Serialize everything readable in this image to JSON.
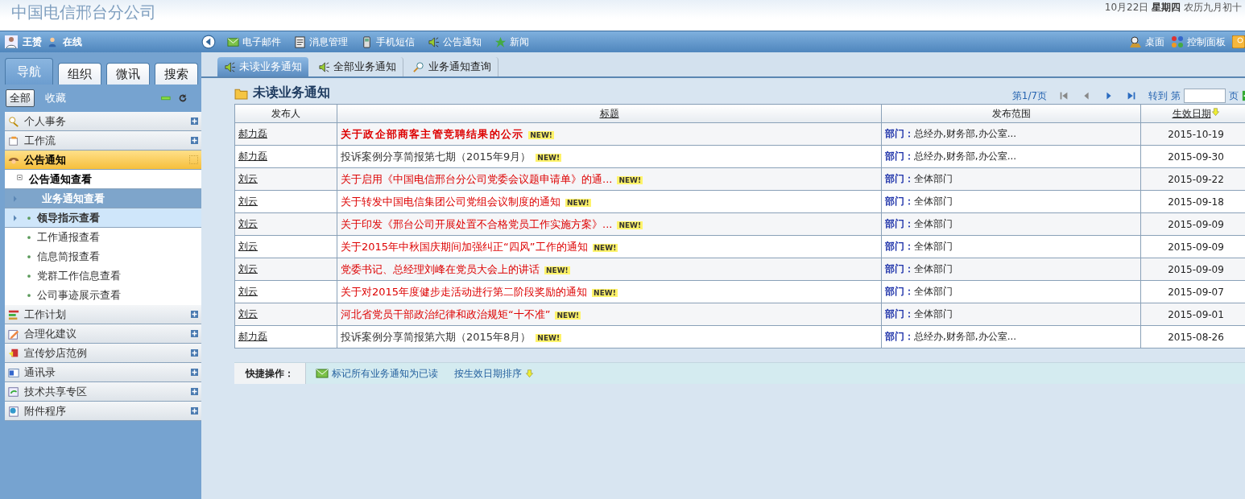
{
  "header": {
    "title": "中国电信邢台分公司",
    "date": "10月22日",
    "weekday": "星期四",
    "lunar": "农历九月初十"
  },
  "topbar": {
    "user": "王赟",
    "status": "在线",
    "menu": [
      {
        "kind": "mail",
        "label": "电子邮件"
      },
      {
        "kind": "message",
        "label": "消息管理"
      },
      {
        "kind": "phone",
        "label": "手机短信"
      },
      {
        "kind": "speaker",
        "label": "公告通知"
      },
      {
        "kind": "star",
        "label": "新闻"
      }
    ],
    "right": [
      {
        "kind": "desktop",
        "label": "桌面"
      },
      {
        "kind": "dots",
        "label": "控制面板"
      }
    ]
  },
  "sidebar": {
    "tabs": [
      {
        "label": "导航",
        "selected": true
      },
      {
        "label": "组织",
        "selected": false
      },
      {
        "label": "微讯",
        "selected": false
      },
      {
        "label": "搜索",
        "selected": false
      }
    ],
    "filters": [
      {
        "label": "全部",
        "selected": true
      },
      {
        "label": "收藏",
        "selected": false
      }
    ],
    "groups": [
      {
        "kind": "person",
        "label": "个人事务",
        "expanded": false
      },
      {
        "kind": "flow",
        "label": "工作流",
        "expanded": false
      },
      {
        "kind": "notice",
        "label": "公告通知",
        "expanded": true,
        "children": [
          {
            "label": "公告通知查看",
            "expanded": true,
            "children": [
              {
                "label": "业务通知查看",
                "selected": true,
                "hovered": false
              },
              {
                "label": "领导指示查看",
                "selected": false,
                "hovered": true
              },
              {
                "label": "工作通报查看",
                "selected": false,
                "hovered": false
              },
              {
                "label": "信息简报查看",
                "selected": false,
                "hovered": false
              },
              {
                "label": "党群工作信息查看",
                "selected": false,
                "hovered": false
              },
              {
                "label": "公司事迹展示查看",
                "selected": false,
                "hovered": false
              }
            ]
          }
        ]
      },
      {
        "kind": "plan",
        "label": "工作计划",
        "expanded": false
      },
      {
        "kind": "pencil",
        "label": "合理化建议",
        "expanded": false
      },
      {
        "kind": "promo",
        "label": "宣传炒店范例",
        "expanded": false
      },
      {
        "kind": "contacts",
        "label": "通讯录",
        "expanded": false
      },
      {
        "kind": "share",
        "label": "技术共享专区",
        "expanded": false
      },
      {
        "kind": "attach",
        "label": "附件程序",
        "expanded": false
      }
    ]
  },
  "tabs": [
    {
      "kind": "speaker",
      "label": "未读业务通知",
      "selected": true
    },
    {
      "kind": "speaker",
      "label": "全部业务通知",
      "selected": false
    },
    {
      "kind": "search",
      "label": "业务通知查询",
      "selected": false
    }
  ],
  "panel": {
    "title": "未读业务通知",
    "page": "第1/7页",
    "goto": "转到 第",
    "page_unit": "页"
  },
  "table": {
    "columns": [
      "发布人",
      "标题",
      "发布范围",
      "生效日期"
    ],
    "rows": [
      {
        "publisher": "郝力磊",
        "title": "关于政企部商客主管竞聘结果的公示",
        "bold": true,
        "color": "#dd0000",
        "badge": "NEW!",
        "scope_label": "部门：",
        "scope": "总经办,财务部,办公室...",
        "date": "2015-10-19"
      },
      {
        "publisher": "郝力磊",
        "title": "投诉案例分享简报第七期（2015年9月）",
        "bold": false,
        "color": "#333333",
        "badge": "NEW!",
        "scope_label": "部门：",
        "scope": "总经办,财务部,办公室...",
        "date": "2015-09-30"
      },
      {
        "publisher": "刘云",
        "title": "关于启用《中国电信邢台分公司党委会议题申请单》的通...",
        "bold": false,
        "color": "#dd0000",
        "badge": "NEW!",
        "scope_label": "部门：",
        "scope": "全体部门",
        "date": "2015-09-22"
      },
      {
        "publisher": "刘云",
        "title": "关于转发中国电信集团公司党组会议制度的通知",
        "bold": false,
        "color": "#dd0000",
        "badge": "NEW!",
        "scope_label": "部门：",
        "scope": "全体部门",
        "date": "2015-09-18"
      },
      {
        "publisher": "刘云",
        "title": "关于印发《邢台公司开展处置不合格党员工作实施方案》...",
        "bold": false,
        "color": "#dd0000",
        "badge": "NEW!",
        "scope_label": "部门：",
        "scope": "全体部门",
        "date": "2015-09-09"
      },
      {
        "publisher": "刘云",
        "title": "关于2015年中秋国庆期间加强纠正“四风”工作的通知",
        "bold": false,
        "color": "#dd0000",
        "badge": "NEW!",
        "scope_label": "部门：",
        "scope": "全体部门",
        "date": "2015-09-09"
      },
      {
        "publisher": "刘云",
        "title": "党委书记、总经理刘峰在党员大会上的讲话",
        "bold": false,
        "color": "#dd0000",
        "badge": "NEW!",
        "scope_label": "部门：",
        "scope": "全体部门",
        "date": "2015-09-09"
      },
      {
        "publisher": "刘云",
        "title": "关于对2015年度健步走活动进行第二阶段奖励的通知",
        "bold": false,
        "color": "#dd0000",
        "badge": "NEW!",
        "scope_label": "部门：",
        "scope": "全体部门",
        "date": "2015-09-07"
      },
      {
        "publisher": "刘云",
        "title": "河北省党员干部政治纪律和政治规矩“十不准”",
        "bold": false,
        "color": "#dd0000",
        "badge": "NEW!",
        "scope_label": "部门：",
        "scope": "全体部门",
        "date": "2015-09-01"
      },
      {
        "publisher": "郝力磊",
        "title": "投诉案例分享简报第六期（2015年8月）",
        "bold": false,
        "color": "#333333",
        "badge": "NEW!",
        "scope_label": "部门：",
        "scope": "总经办,财务部,办公室...",
        "date": "2015-08-26"
      }
    ]
  },
  "quick": {
    "label": "快捷操作：",
    "actions": [
      {
        "kind": "mail",
        "label": "标记所有业务通知为已读"
      },
      {
        "kind": "sort",
        "label": "按生效日期排序"
      }
    ]
  }
}
